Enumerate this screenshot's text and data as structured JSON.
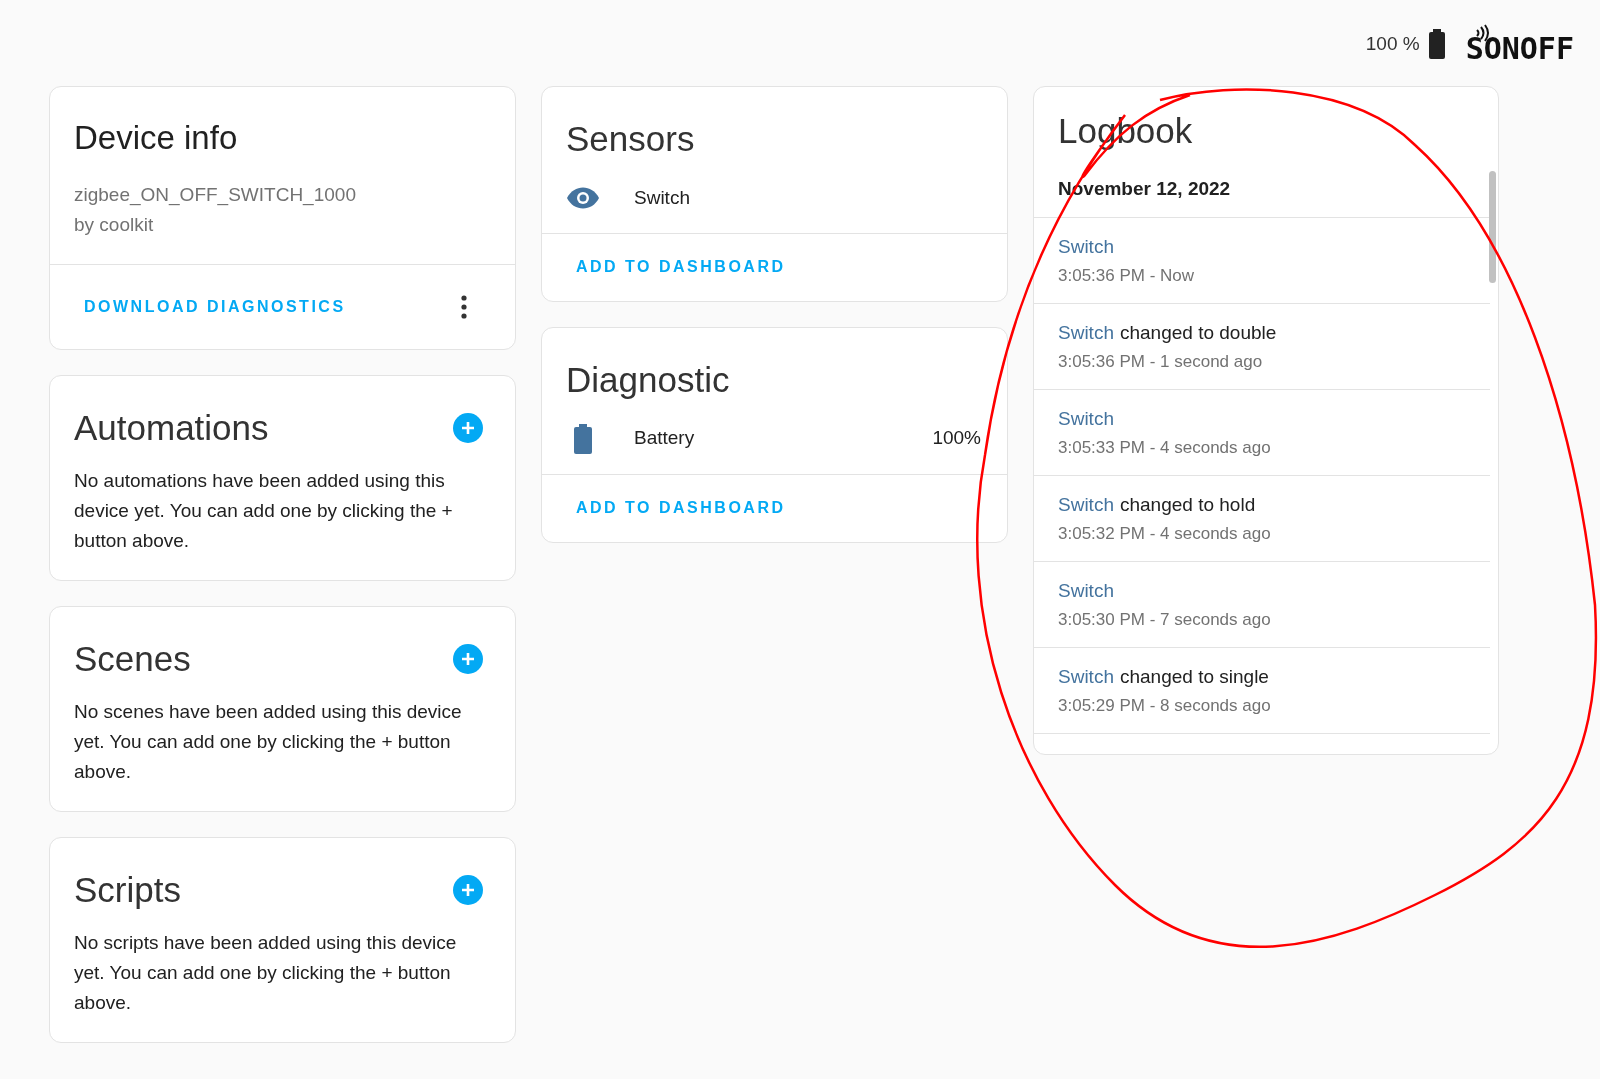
{
  "header": {
    "battery_text": "100 %",
    "logo": "SONOFF"
  },
  "device_info": {
    "title": "Device info",
    "model": "zigbee_ON_OFF_SWITCH_1000",
    "manufacturer": "by coolkit",
    "action": "DOWNLOAD DIAGNOSTICS"
  },
  "automations": {
    "title": "Automations",
    "text": "No automations have been added using this device yet. You can add one by clicking the + button above."
  },
  "scenes": {
    "title": "Scenes",
    "text": "No scenes have been added using this device yet. You can add one by clicking the + button above."
  },
  "scripts": {
    "title": "Scripts",
    "text": "No scripts have been added using this device yet. You can add one by clicking the + button above."
  },
  "sensors": {
    "title": "Sensors",
    "entities": [
      {
        "kind": "eye",
        "name": "Switch"
      }
    ],
    "action": "ADD TO DASHBOARD"
  },
  "diagnostic": {
    "title": "Diagnostic",
    "entities": [
      {
        "kind": "battery",
        "name": "Battery",
        "value": "100%"
      }
    ],
    "action": "ADD TO DASHBOARD"
  },
  "logbook": {
    "title": "Logbook",
    "date": "November 12, 2022",
    "entries": [
      {
        "entity": "Switch",
        "time": "3:05:36 PM - Now"
      },
      {
        "entity": "Switch",
        "message": "changed to double",
        "time": "3:05:36 PM - 1 second ago"
      },
      {
        "entity": "Switch",
        "time": "3:05:33 PM - 4 seconds ago"
      },
      {
        "entity": "Switch",
        "message": "changed to hold",
        "time": "3:05:32 PM - 4 seconds ago"
      },
      {
        "entity": "Switch",
        "time": "3:05:30 PM - 7 seconds ago"
      },
      {
        "entity": "Switch",
        "message": "changed to single",
        "time": "3:05:29 PM - 8 seconds ago"
      }
    ]
  }
}
